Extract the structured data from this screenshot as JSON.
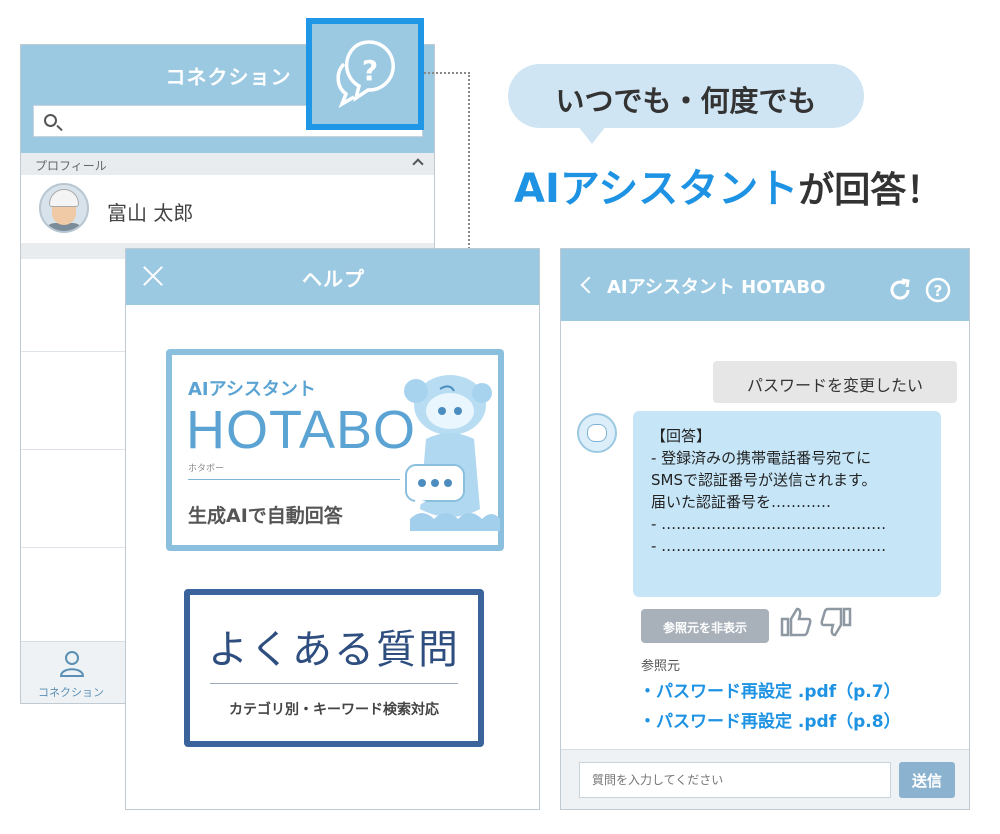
{
  "connection_panel": {
    "title": "コネクション",
    "section_label": "プロフィール",
    "profile_name": "富山 太郎",
    "footer_tab_label": "コネクション"
  },
  "help_panel": {
    "title": "ヘルプ",
    "ai_card": {
      "kicker": "AIアシスタント",
      "name": "HOTABO",
      "ruby": "ホタボー",
      "subtitle": "生成AIで自動回答"
    },
    "faq_card": {
      "title": "よくある質問",
      "subtitle": "カテゴリ別・キーワード検索対応"
    }
  },
  "headline": {
    "bubble": "いつでも・何度でも",
    "main": "AIアシスタント",
    "tail": "が回答！"
  },
  "chat_panel": {
    "title": "AIアシスタント HOTABO",
    "user_message": "パスワードを変更したい",
    "bot_message_lines": [
      "【回答】",
      "- 登録済みの携帯電話番号宛てに",
      "SMSで認証番号が送信されます。",
      "届いた認証番号を…………",
      "- ………………………………………",
      "- ………………………………………"
    ],
    "hide_sources_label": "参照元を非表示",
    "references_label": "参照元",
    "references": [
      "・パスワード再設定 .pdf（p.7）",
      "・パスワード再設定 .pdf（p.8）"
    ],
    "input_placeholder": "質問を入力してください",
    "send_label": "送信"
  },
  "colors": {
    "header_blue": "#9cc9e2",
    "accent_blue": "#1e93e3",
    "faq_navy": "#3a629b"
  }
}
